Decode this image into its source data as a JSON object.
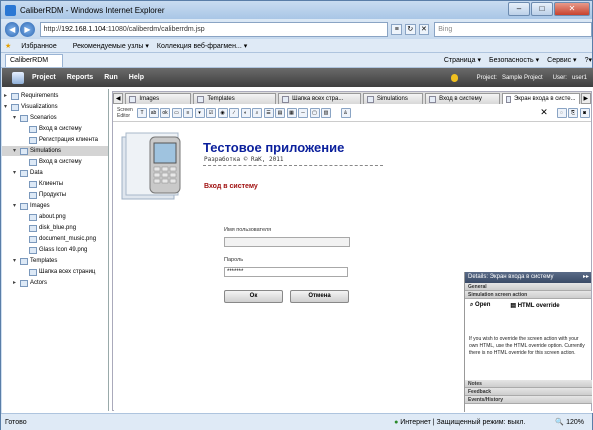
{
  "window": {
    "title": "CaliberRDM - Windows Internet Explorer"
  },
  "address": {
    "url_prefix": "http://",
    "url_host": "192.168.1.104",
    "url_path": ":11080/caliberdm/caliberrdm.jsp",
    "search_placeholder": "Bing"
  },
  "favorites": {
    "label": "Избранное",
    "item1": "Рекомендуемые узлы ▾",
    "item2": "Коллекция веб-фрагмен... ▾"
  },
  "browser_tab": {
    "label": "CaliberRDM"
  },
  "commands": {
    "page": "Страница ▾",
    "security": "Безопасность ▾",
    "service": "Сервис ▾",
    "help": "?▾"
  },
  "menu": {
    "project": "Project",
    "reports": "Reports",
    "run": "Run",
    "help": "Help",
    "project_label": "Project:",
    "project_value": "Sample Project",
    "user_label": "User:",
    "user_value": "user1"
  },
  "tree": [
    {
      "label": "Requirements",
      "exp": "▸",
      "indent": 0
    },
    {
      "label": "Visualizations",
      "exp": "▾",
      "indent": 0
    },
    {
      "label": "Scenarios",
      "exp": "▾",
      "indent": 1
    },
    {
      "label": "Вход в систему",
      "exp": "",
      "indent": 2
    },
    {
      "label": "Регистрация клиента",
      "exp": "",
      "indent": 2
    },
    {
      "label": "Simulations",
      "exp": "▾",
      "indent": 1,
      "selected": true
    },
    {
      "label": "Вход в систему",
      "exp": "",
      "indent": 2
    },
    {
      "label": "Data",
      "exp": "▾",
      "indent": 1
    },
    {
      "label": "Клиенты",
      "exp": "",
      "indent": 2
    },
    {
      "label": "Продукты",
      "exp": "",
      "indent": 2
    },
    {
      "label": "Images",
      "exp": "▾",
      "indent": 1
    },
    {
      "label": "about.png",
      "exp": "",
      "indent": 2
    },
    {
      "label": "disk_blue.png",
      "exp": "",
      "indent": 2
    },
    {
      "label": "document_music.png",
      "exp": "",
      "indent": 2
    },
    {
      "label": "Glass Icon 49.png",
      "exp": "",
      "indent": 2
    },
    {
      "label": "Templates",
      "exp": "▾",
      "indent": 1
    },
    {
      "label": "Шапка всех страниц",
      "exp": "",
      "indent": 2
    },
    {
      "label": "Actors",
      "exp": "▸",
      "indent": 1
    }
  ],
  "editor_tabs": [
    "Images",
    "Templates",
    "Шапка всех стра...",
    "Simulations",
    "Вход в систему",
    "Экран входа в систе..."
  ],
  "toolbar": {
    "label": "Screen Editor"
  },
  "screen": {
    "title": "Тестовое приложение",
    "subtitle": "Разработка © RaK, 2011",
    "login_title": "Вход в систему",
    "username_label": "Имя пользователя",
    "password_label": "Пароль",
    "password_value": "*******",
    "ok_label": "Ок",
    "cancel_label": "Отмена"
  },
  "details": {
    "header": "Details: Экран входа в систему",
    "general": "General",
    "action_section": "Simulation screen action",
    "open_label": "Open",
    "html_label": "HTML override",
    "description": "If you wish to override the screen action with your own HTML, use the HTML override option. Currently there is no HTML override for this screen action.",
    "notes": "Notes",
    "feedback": "Feedback",
    "events": "Events/History"
  },
  "status": {
    "left": "Готово",
    "middle": "Интернет | Защищенный режим: выкл.",
    "zoom": "120%"
  }
}
